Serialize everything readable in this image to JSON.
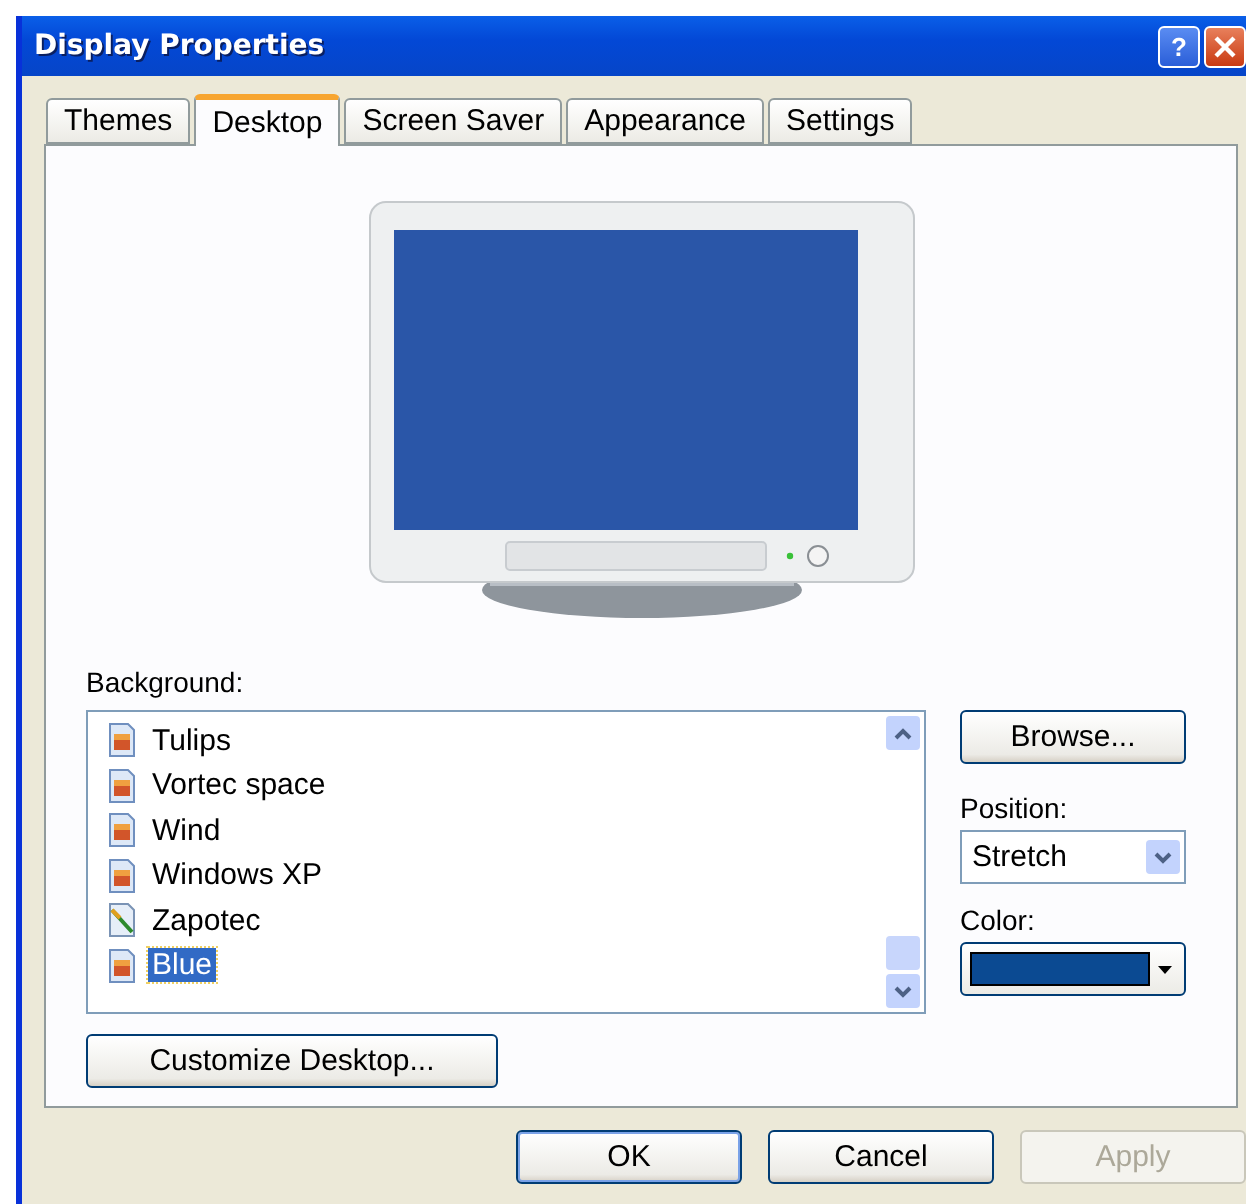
{
  "window": {
    "title": "Display Properties",
    "help_glyph": "?"
  },
  "tabs": [
    {
      "label": "Themes",
      "selected": false
    },
    {
      "label": "Desktop",
      "selected": true
    },
    {
      "label": "Screen Saver",
      "selected": false
    },
    {
      "label": "Appearance",
      "selected": false
    },
    {
      "label": "Settings",
      "selected": false
    }
  ],
  "background": {
    "label": "Background:",
    "items": [
      {
        "label": "Tulips",
        "kind": "picture",
        "selected": false
      },
      {
        "label": "Vortec space",
        "kind": "picture",
        "selected": false
      },
      {
        "label": "Wind",
        "kind": "picture",
        "selected": false
      },
      {
        "label": "Windows XP",
        "kind": "picture",
        "selected": false
      },
      {
        "label": "Zapotec",
        "kind": "document",
        "selected": false
      },
      {
        "label": "Blue",
        "kind": "picture",
        "selected": true
      }
    ]
  },
  "browse_button": "Browse...",
  "position": {
    "label": "Position:",
    "value": "Stretch"
  },
  "color_picker": {
    "label": "Color:",
    "color": "#0b4a92"
  },
  "customize_button": "Customize Desktop...",
  "buttons": [
    {
      "label": "OK",
      "disabled": false,
      "default": true
    },
    {
      "label": "Cancel",
      "disabled": false,
      "default": false
    },
    {
      "label": "Apply",
      "disabled": true,
      "default": false
    }
  ]
}
